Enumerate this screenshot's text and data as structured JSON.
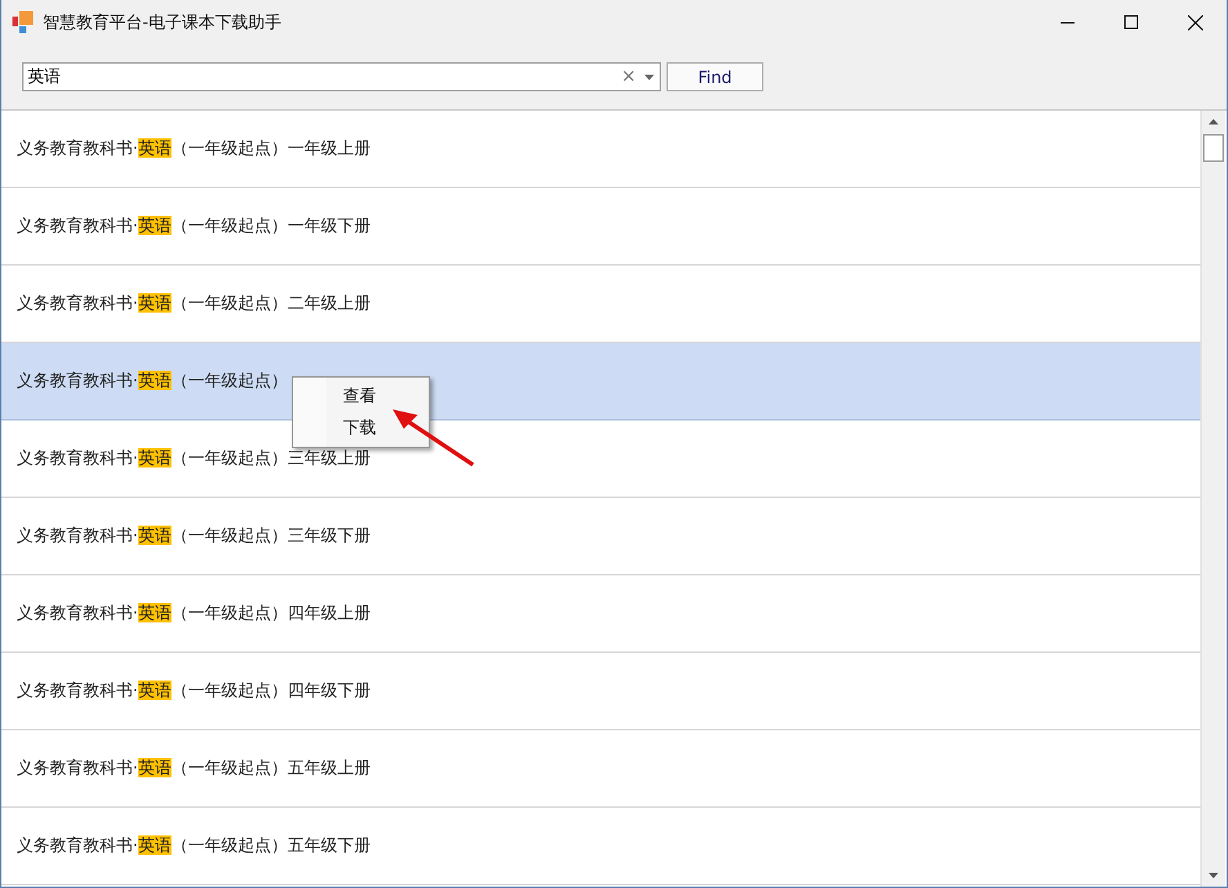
{
  "window": {
    "title": "智慧教育平台-电子课本下载助手"
  },
  "search": {
    "value": "英语",
    "clear": "×",
    "button": "Find"
  },
  "rows": [
    {
      "prefix": "义务教育教科书·",
      "match": "英语",
      "suffix": "（一年级起点）一年级上册",
      "selected": false
    },
    {
      "prefix": "义务教育教科书·",
      "match": "英语",
      "suffix": "（一年级起点）一年级下册",
      "selected": false
    },
    {
      "prefix": "义务教育教科书·",
      "match": "英语",
      "suffix": "（一年级起点）二年级上册",
      "selected": false
    },
    {
      "prefix": "义务教育教科书·",
      "match": "英语",
      "suffix": "（一年级起点）",
      "selected": true
    },
    {
      "prefix": "义务教育教科书·",
      "match": "英语",
      "suffix": "（一年级起点）三年级上册",
      "selected": false
    },
    {
      "prefix": "义务教育教科书·",
      "match": "英语",
      "suffix": "（一年级起点）三年级下册",
      "selected": false
    },
    {
      "prefix": "义务教育教科书·",
      "match": "英语",
      "suffix": "（一年级起点）四年级上册",
      "selected": false
    },
    {
      "prefix": "义务教育教科书·",
      "match": "英语",
      "suffix": "（一年级起点）四年级下册",
      "selected": false
    },
    {
      "prefix": "义务教育教科书·",
      "match": "英语",
      "suffix": "（一年级起点）五年级上册",
      "selected": false
    },
    {
      "prefix": "义务教育教科书·",
      "match": "英语",
      "suffix": "（一年级起点）五年级下册",
      "selected": false
    }
  ],
  "context_menu": {
    "items": [
      "查看",
      "下载"
    ]
  }
}
